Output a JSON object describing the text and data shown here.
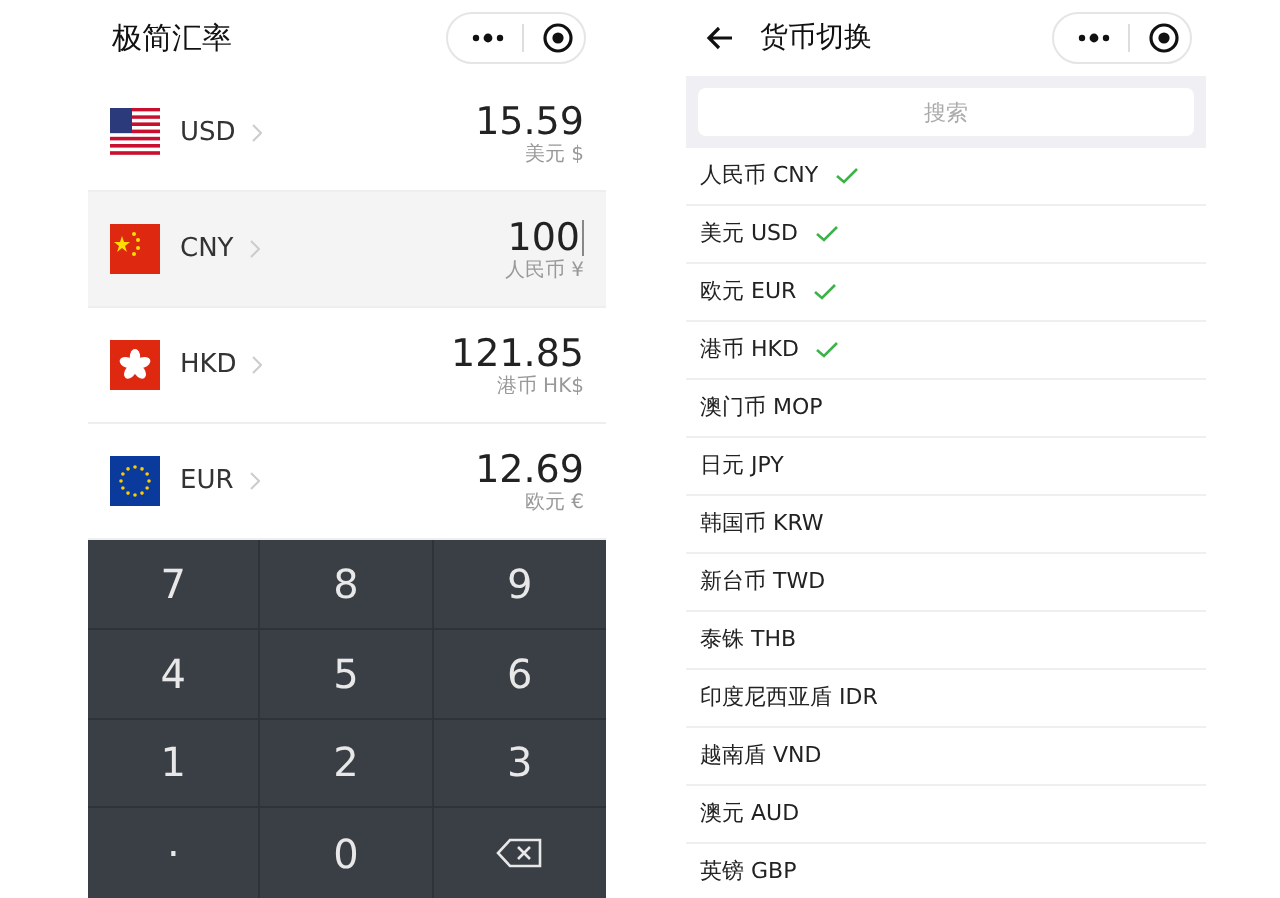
{
  "converter": {
    "title": "极简汇率",
    "rows": [
      {
        "code": "USD",
        "amount": "15.59",
        "unit": "美元 $",
        "selected": false
      },
      {
        "code": "CNY",
        "amount": "100",
        "unit": "人民币 ¥",
        "selected": true
      },
      {
        "code": "HKD",
        "amount": "121.85",
        "unit": "港币 HK$",
        "selected": false
      },
      {
        "code": "EUR",
        "amount": "12.69",
        "unit": "欧元 €",
        "selected": false
      }
    ],
    "keypad": [
      {
        "kind": "digit",
        "label": "7"
      },
      {
        "kind": "digit",
        "label": "8"
      },
      {
        "kind": "digit",
        "label": "9"
      },
      {
        "kind": "digit",
        "label": "4"
      },
      {
        "kind": "digit",
        "label": "5"
      },
      {
        "kind": "digit",
        "label": "6"
      },
      {
        "kind": "digit",
        "label": "1"
      },
      {
        "kind": "digit",
        "label": "2"
      },
      {
        "kind": "digit",
        "label": "3"
      },
      {
        "kind": "point",
        "label": "."
      },
      {
        "kind": "digit",
        "label": "0"
      },
      {
        "kind": "backspace"
      }
    ]
  },
  "switcher": {
    "title": "货币切换",
    "search": {
      "placeholder": "搜索"
    },
    "items": [
      {
        "label": "人民币 CNY",
        "checked": true
      },
      {
        "label": "美元 USD",
        "checked": true
      },
      {
        "label": "欧元 EUR",
        "checked": true
      },
      {
        "label": "港币 HKD",
        "checked": true
      },
      {
        "label": "澳门币 MOP",
        "checked": false
      },
      {
        "label": "日元 JPY",
        "checked": false
      },
      {
        "label": "韩国币 KRW",
        "checked": false
      },
      {
        "label": "新台币 TWD",
        "checked": false
      },
      {
        "label": "泰铢 THB",
        "checked": false
      },
      {
        "label": "印度尼西亚盾 IDR",
        "checked": false
      },
      {
        "label": "越南盾 VND",
        "checked": false
      },
      {
        "label": "澳元 AUD",
        "checked": false
      },
      {
        "label": "英镑 GBP",
        "checked": false
      }
    ]
  }
}
